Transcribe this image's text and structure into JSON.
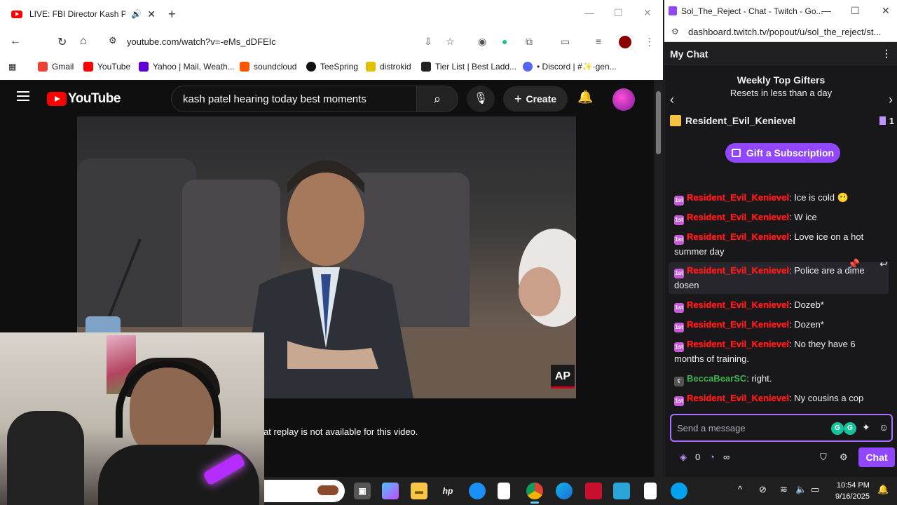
{
  "browser_left": {
    "tab_title": "LIVE: FBI Director Kash Pate",
    "url": "youtube.com/watch?v=-eMs_dDFEIc",
    "bookmarks": [
      {
        "label": "Gmail",
        "color": "#ea4335"
      },
      {
        "label": "YouTube",
        "color": "#ff0000"
      },
      {
        "label": "Yahoo | Mail, Weath...",
        "color": "#6001d2"
      },
      {
        "label": "soundcloud",
        "color": "#ff5500"
      },
      {
        "label": "TeeSpring",
        "color": "#111111"
      },
      {
        "label": "distrokid",
        "color": "#e0c000"
      },
      {
        "label": "Tier List | Best Ladd...",
        "color": "#222222"
      },
      {
        "label": "• Discord | #✨·gen...",
        "color": "#5865f2"
      }
    ]
  },
  "youtube": {
    "logo_text": "YouTube",
    "search_value": "kash patel hearing today best moments",
    "create_label": "Create",
    "ap_label": "AP",
    "chat_notice": "at replay is not available for this video."
  },
  "twitch_window": {
    "title": "Sol_The_Reject - Chat - Twitch - Go...",
    "url": "dashboard.twitch.tv/popout/u/sol_the_reject/st..."
  },
  "twitch": {
    "header": "My Chat",
    "gifters_title": "Weekly Top Gifters",
    "gifters_subtitle": "Resets in less than a day",
    "top_gifter": "Resident_Evil_Kenievel",
    "top_gifter_count": "1",
    "gift_button": "Gift a Subscription",
    "messages": [
      {
        "user": "Resident_Evil_Kenievel",
        "text": ": Ice is cold 😶"
      },
      {
        "user": "Resident_Evil_Kenievel",
        "text": ": W ice"
      },
      {
        "user": "Resident_Evil_Kenievel",
        "text": ": Love ice on a hot summer day"
      },
      {
        "user": "Resident_Evil_Kenievel",
        "text": ": Police are a dime dosen"
      },
      {
        "user": "Resident_Evil_Kenievel",
        "text": ": Dozeb*"
      },
      {
        "user": "Resident_Evil_Kenievel",
        "text": ": Dozen*"
      },
      {
        "user": "Resident_Evil_Kenievel",
        "text": ": No they have 6 months of training."
      },
      {
        "user": "BeccaBearSC",
        "text": ": right."
      },
      {
        "user": "Resident_Evil_Kenievel",
        "text": ": Ny cousins a cop"
      }
    ],
    "input_placeholder": "Send a message",
    "points": "0",
    "infinity": "∞",
    "chat_button": "Chat"
  },
  "taskbar": {
    "time": "10:54 PM",
    "date": "9/16/2025"
  }
}
